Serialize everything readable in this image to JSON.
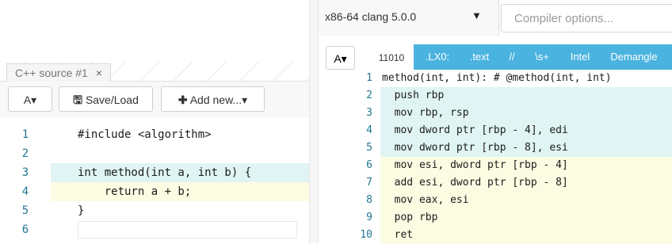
{
  "source": {
    "tab_label": "C++ source #1",
    "tab_close": "×",
    "font_button": "A▾",
    "save_load": "Save/Load",
    "add_new": "Add new...▾",
    "lines": [
      {
        "num": "1",
        "code": "#include <algorithm>"
      },
      {
        "num": "2",
        "code": ""
      },
      {
        "num": "3",
        "code": "int method(int a, int b) {"
      },
      {
        "num": "4",
        "code": "    return a + b;"
      },
      {
        "num": "5",
        "code": "}"
      },
      {
        "num": "6",
        "code": ""
      }
    ]
  },
  "compiler": {
    "selected": "x86-64 clang 5.0.0",
    "options_placeholder": "Compiler options...",
    "font_button": "A▾",
    "binary_label": "11010",
    "filters": [
      ".LX0:",
      ".text",
      "//",
      "\\s+",
      "Intel",
      "Demangle"
    ]
  },
  "asm": {
    "lines": [
      {
        "num": "1",
        "code": "method(int, int): # @method(int, int)"
      },
      {
        "num": "2",
        "code": "  push rbp"
      },
      {
        "num": "3",
        "code": "  mov rbp, rsp"
      },
      {
        "num": "4",
        "code": "  mov dword ptr [rbp - 4], edi"
      },
      {
        "num": "5",
        "code": "  mov dword ptr [rbp - 8], esi"
      },
      {
        "num": "6",
        "code": "  mov esi, dword ptr [rbp - 4]"
      },
      {
        "num": "7",
        "code": "  add esi, dword ptr [rbp - 8]"
      },
      {
        "num": "8",
        "code": "  mov eax, esi"
      },
      {
        "num": "9",
        "code": "  pop rbp"
      },
      {
        "num": "10",
        "code": "  ret"
      }
    ]
  },
  "colors": {
    "filter_blue": "#4ab3df",
    "highlight_blue": "#e0f4f4",
    "highlight_yellow": "#fcfce3",
    "line_number": "#237893",
    "keyword": "#0000ff"
  }
}
